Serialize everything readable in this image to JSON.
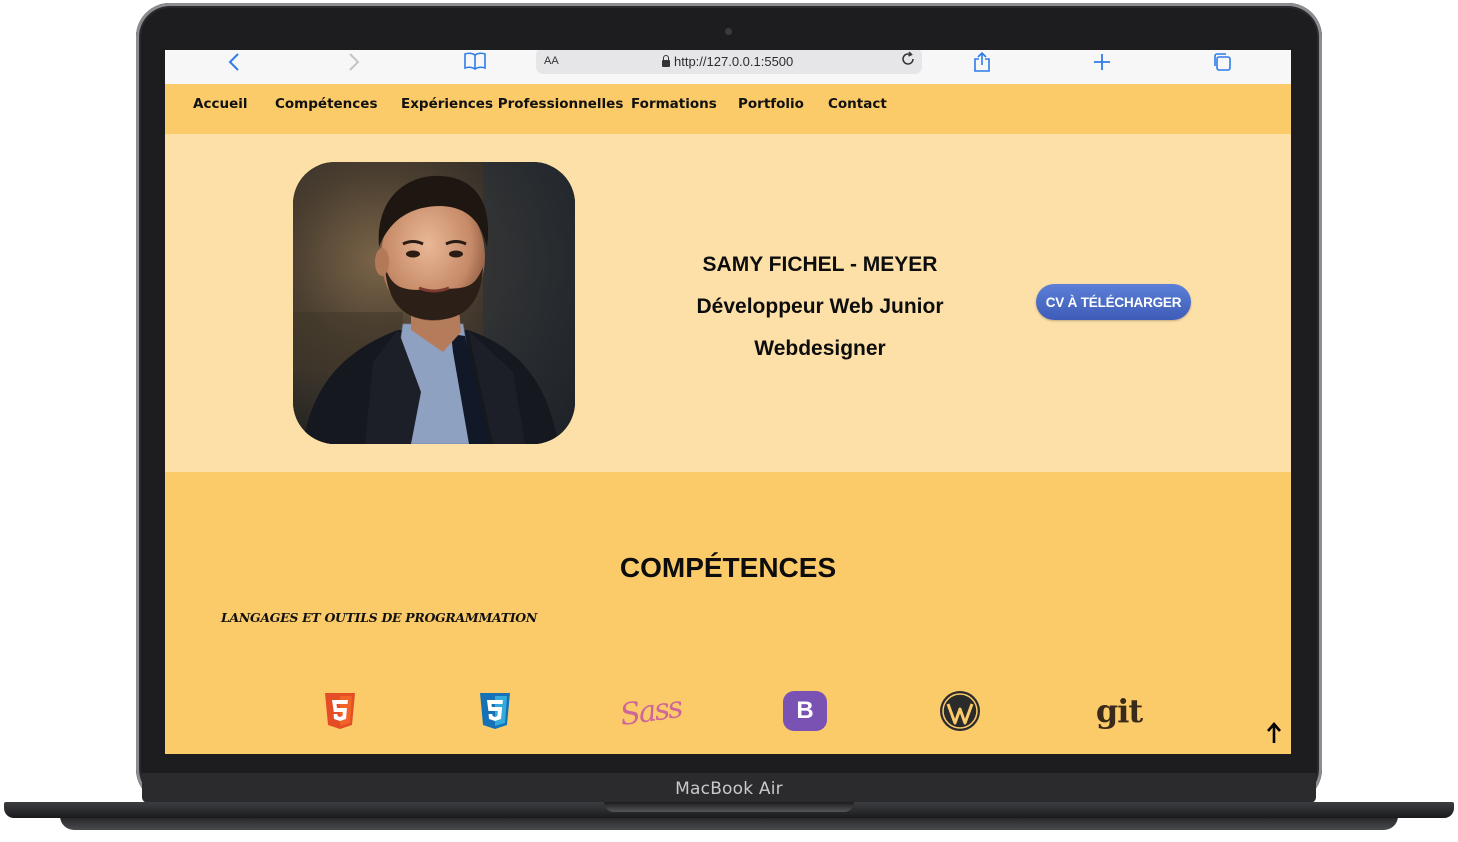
{
  "device": {
    "label": "MacBook Air"
  },
  "browser": {
    "url": "http://127.0.0.1:5500",
    "text_size_label": "AA",
    "icons": [
      "back-icon",
      "forward-icon",
      "bookmarks-icon",
      "reload-icon",
      "share-icon",
      "new-tab-icon",
      "tabs-icon"
    ]
  },
  "nav": {
    "items": [
      "Accueil",
      "Compétences",
      "Expériences Professionnelles",
      "Formations",
      "Portfolio",
      "Contact"
    ]
  },
  "hero": {
    "name": "SAMY FICHEL - MEYER",
    "role": "Développeur Web Junior",
    "role2": "Webdesigner",
    "cv_button": "CV À TÉLÉCHARGER"
  },
  "skills": {
    "title": "COMPÉTENCES",
    "subtitle": "LANGAGES ET OUTILS DE PROGRAMMATION",
    "icons": [
      "html5-icon",
      "css3-icon",
      "sass-icon",
      "bootstrap-icon",
      "wordpress-icon",
      "git-icon"
    ],
    "sass_logo_text": "Sass",
    "bootstrap_logo_text": "B",
    "git_logo_text": "git"
  },
  "colors": {
    "nav_bg": "#fccb69",
    "hero_bg": "#fde0a8",
    "button": "#4a68c2",
    "html5": "#e44d26",
    "css3": "#1f6fd0",
    "sass": "#cd6799",
    "bootstrap": "#7952b3",
    "wordpress": "#2b2b2b",
    "git": "#3a2a1a"
  }
}
